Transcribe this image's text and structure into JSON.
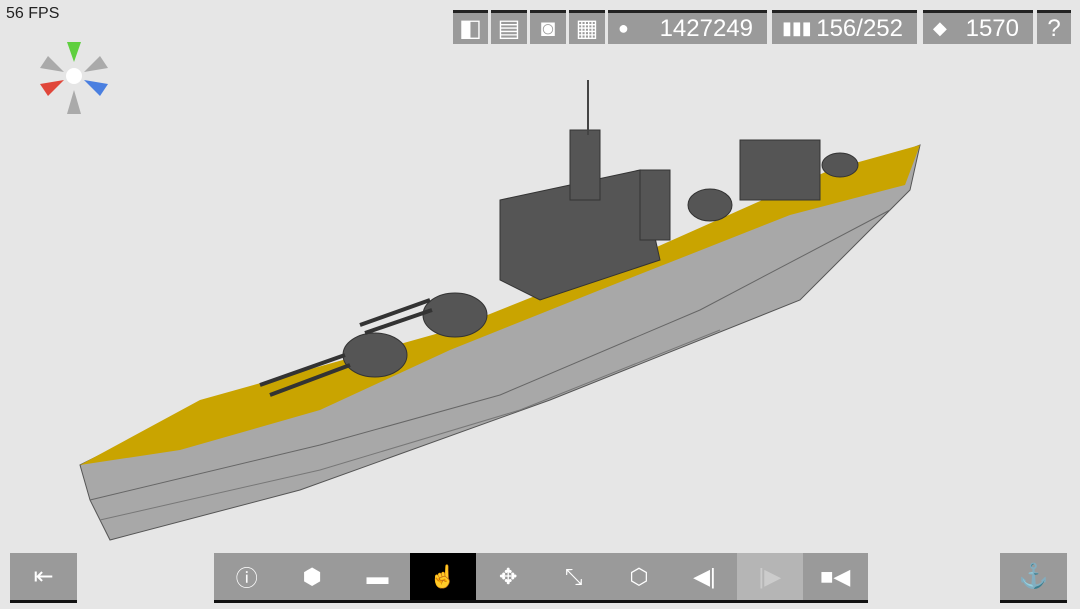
{
  "fps": "56 FPS",
  "top": {
    "money": "1427249",
    "ammo": "156/252",
    "parts": "1570"
  },
  "icons": {
    "top": [
      "map-icon",
      "save-icon",
      "camera-icon",
      "grid-icon",
      "money-icon",
      "ammo-icon",
      "parts-icon",
      "help-icon"
    ],
    "bottom": [
      "info-icon",
      "add-part-icon",
      "paint-roller-icon",
      "hand-pointer-icon",
      "move-icon",
      "scale-icon",
      "remove-part-icon",
      "undo-icon",
      "redo-icon",
      "video-camera-icon"
    ]
  },
  "colors": {
    "deck": "#c9a400",
    "hull": "#a9a9a9",
    "button": "#9a9a9a",
    "active": "#000000"
  }
}
